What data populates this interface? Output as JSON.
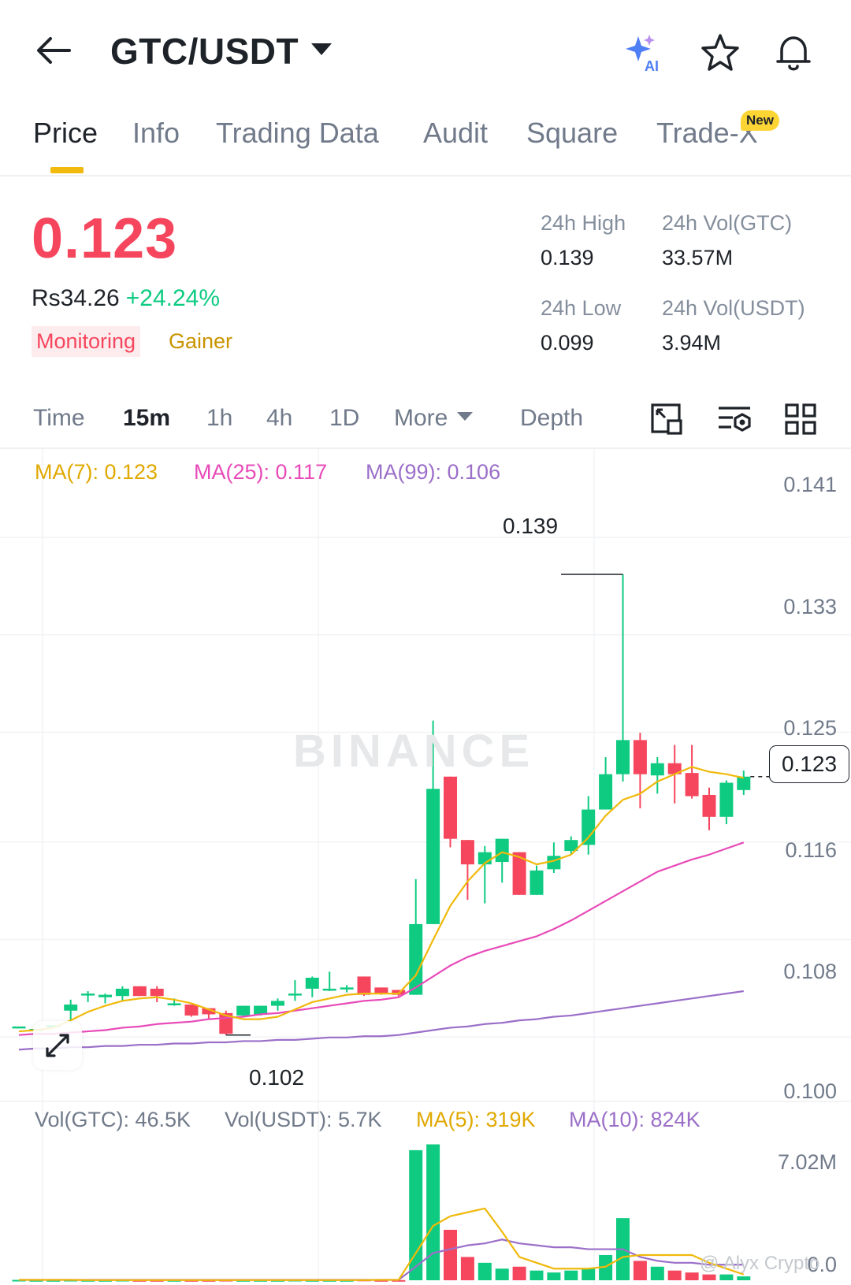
{
  "header": {
    "pair": "GTC/USDT",
    "ai_icon": "ai-sparkle-icon",
    "star_icon": "star-icon",
    "bell_icon": "bell-icon"
  },
  "tabs": [
    {
      "label": "Price",
      "active": true
    },
    {
      "label": "Info"
    },
    {
      "label": "Trading Data"
    },
    {
      "label": "Audit"
    },
    {
      "label": "Square"
    },
    {
      "label": "Trade-X",
      "badge": "New"
    }
  ],
  "price": {
    "last": "0.123",
    "fiat": "Rs34.26",
    "change": "+24.24%",
    "tags": [
      "Monitoring",
      "Gainer"
    ]
  },
  "stats": {
    "high_label": "24h High",
    "high_value": "0.139",
    "vol_base_label": "24h Vol(GTC)",
    "vol_base_value": "33.57M",
    "low_label": "24h Low",
    "low_value": "0.099",
    "vol_quote_label": "24h Vol(USDT)",
    "vol_quote_value": "3.94M"
  },
  "intervals": {
    "time": "Time",
    "m15": "15m",
    "h1": "1h",
    "h4": "4h",
    "d1": "1D",
    "more": "More",
    "depth": "Depth"
  },
  "indicators": {
    "ma7": "MA(7): 0.123",
    "ma25": "MA(25): 0.117",
    "ma99": "MA(99): 0.106",
    "vol_base": "Vol(GTC): 46.5K",
    "vol_quote": "Vol(USDT): 5.7K",
    "vol_ma5": "MA(5): 319K",
    "vol_ma10": "MA(10): 824K"
  },
  "colors": {
    "up": "#0ecb81",
    "down": "#f6465d",
    "ma7": "#f0b90b",
    "ma25": "#e84ab8",
    "ma99": "#9b6fc9",
    "accent": "#f0b90b"
  },
  "watermark": "BINANCE",
  "credit": "@ Alyx Crypto",
  "chart_data": {
    "type": "candlestick",
    "y_axis_labels": [
      "0.141",
      "0.133",
      "0.125",
      "0.116",
      "0.108",
      "0.100"
    ],
    "ylim": [
      0.0995,
      0.1432
    ],
    "current_price": "0.123",
    "high_mark": "0.139",
    "low_mark": "0.102",
    "candles": [
      {
        "o": 0.1019,
        "h": 0.1019,
        "l": 0.1019,
        "c": 0.1019
      },
      {
        "o": 0.1017,
        "h": 0.1017,
        "l": 0.1017,
        "c": 0.1017
      },
      {
        "o": 0.1019,
        "h": 0.102,
        "l": 0.1019,
        "c": 0.102
      },
      {
        "o": 0.1032,
        "h": 0.1041,
        "l": 0.1022,
        "c": 0.1037
      },
      {
        "o": 0.1045,
        "h": 0.1048,
        "l": 0.1039,
        "c": 0.1046
      },
      {
        "o": 0.1043,
        "h": 0.1046,
        "l": 0.1038,
        "c": 0.1045
      },
      {
        "o": 0.1044,
        "h": 0.1052,
        "l": 0.104,
        "c": 0.105
      },
      {
        "o": 0.1052,
        "h": 0.1052,
        "l": 0.1044,
        "c": 0.1044
      },
      {
        "o": 0.105,
        "h": 0.1052,
        "l": 0.1039,
        "c": 0.1044
      },
      {
        "o": 0.1038,
        "h": 0.1042,
        "l": 0.1036,
        "c": 0.1038
      },
      {
        "o": 0.1037,
        "h": 0.1037,
        "l": 0.1027,
        "c": 0.1028
      },
      {
        "o": 0.1034,
        "h": 0.1034,
        "l": 0.1025,
        "c": 0.1029
      },
      {
        "o": 0.103,
        "h": 0.1032,
        "l": 0.1012,
        "c": 0.1013
      },
      {
        "o": 0.1028,
        "h": 0.1036,
        "l": 0.1027,
        "c": 0.1036
      },
      {
        "o": 0.1029,
        "h": 0.1036,
        "l": 0.1028,
        "c": 0.1036
      },
      {
        "o": 0.1036,
        "h": 0.1042,
        "l": 0.1032,
        "c": 0.104
      },
      {
        "o": 0.1045,
        "h": 0.1057,
        "l": 0.104,
        "c": 0.1046
      },
      {
        "o": 0.105,
        "h": 0.106,
        "l": 0.1043,
        "c": 0.1059
      },
      {
        "o": 0.105,
        "h": 0.1064,
        "l": 0.1048,
        "c": 0.105
      },
      {
        "o": 0.105,
        "h": 0.1053,
        "l": 0.1047,
        "c": 0.1051
      },
      {
        "o": 0.106,
        "h": 0.106,
        "l": 0.1044,
        "c": 0.1045
      },
      {
        "o": 0.1051,
        "h": 0.1051,
        "l": 0.1045,
        "c": 0.1046
      },
      {
        "o": 0.1049,
        "h": 0.1049,
        "l": 0.1044,
        "c": 0.1045
      },
      {
        "o": 0.1045,
        "h": 0.114,
        "l": 0.1045,
        "c": 0.1103
      },
      {
        "o": 0.1103,
        "h": 0.127,
        "l": 0.1103,
        "c": 0.1214
      },
      {
        "o": 0.1224,
        "h": 0.1224,
        "l": 0.1166,
        "c": 0.1173
      },
      {
        "o": 0.1172,
        "h": 0.1172,
        "l": 0.1123,
        "c": 0.1152
      },
      {
        "o": 0.1152,
        "h": 0.1167,
        "l": 0.112,
        "c": 0.1162
      },
      {
        "o": 0.1154,
        "h": 0.1173,
        "l": 0.1137,
        "c": 0.1173
      },
      {
        "o": 0.1162,
        "h": 0.1162,
        "l": 0.1127,
        "c": 0.1127
      },
      {
        "o": 0.1127,
        "h": 0.1151,
        "l": 0.1127,
        "c": 0.1147
      },
      {
        "o": 0.1148,
        "h": 0.117,
        "l": 0.1145,
        "c": 0.1159
      },
      {
        "o": 0.1163,
        "h": 0.1175,
        "l": 0.116,
        "c": 0.1172
      },
      {
        "o": 0.1168,
        "h": 0.1208,
        "l": 0.116,
        "c": 0.1197
      },
      {
        "o": 0.1197,
        "h": 0.124,
        "l": 0.1197,
        "c": 0.1226
      },
      {
        "o": 0.1226,
        "h": 0.139,
        "l": 0.122,
        "c": 0.1254
      },
      {
        "o": 0.1254,
        "h": 0.126,
        "l": 0.1198,
        "c": 0.1226
      },
      {
        "o": 0.1225,
        "h": 0.124,
        "l": 0.121,
        "c": 0.1235
      },
      {
        "o": 0.1235,
        "h": 0.125,
        "l": 0.1202,
        "c": 0.1226
      },
      {
        "o": 0.1227,
        "h": 0.125,
        "l": 0.1206,
        "c": 0.1208
      },
      {
        "o": 0.1209,
        "h": 0.1215,
        "l": 0.118,
        "c": 0.1191
      },
      {
        "o": 0.1191,
        "h": 0.1221,
        "l": 0.1185,
        "c": 0.1219
      },
      {
        "o": 0.1213,
        "h": 0.1229,
        "l": 0.1209,
        "c": 0.1224
      }
    ],
    "ma7": [
      0.1015,
      0.1016,
      0.1018,
      0.1024,
      0.1031,
      0.1036,
      0.104,
      0.1042,
      0.1043,
      0.1041,
      0.1038,
      0.1033,
      0.1028,
      0.1025,
      0.1025,
      0.1027,
      0.1033,
      0.1039,
      0.1042,
      0.1045,
      0.1046,
      0.1046,
      0.1046,
      0.1061,
      0.109,
      0.1118,
      0.1138,
      0.1153,
      0.1162,
      0.1158,
      0.1152,
      0.1155,
      0.116,
      0.1174,
      0.1192,
      0.1205,
      0.121,
      0.122,
      0.1226,
      0.1232,
      0.1228,
      0.1226,
      0.1223
    ],
    "ma25": [
      0.1012,
      0.1013,
      0.1013,
      0.1014,
      0.1015,
      0.1016,
      0.1018,
      0.1019,
      0.1021,
      0.1022,
      0.1023,
      0.1025,
      0.1026,
      0.1027,
      0.1029,
      0.103,
      0.1032,
      0.1034,
      0.1036,
      0.1038,
      0.104,
      0.1041,
      0.1043,
      0.1051,
      0.106,
      0.1069,
      0.1076,
      0.1081,
      0.1085,
      0.1089,
      0.1093,
      0.1099,
      0.1106,
      0.1114,
      0.1122,
      0.113,
      0.1138,
      0.1146,
      0.1151,
      0.1156,
      0.116,
      0.1165,
      0.117
    ],
    "ma99": [
      0.1,
      0.1001,
      0.1001,
      0.1002,
      0.1002,
      0.1003,
      0.1003,
      0.1004,
      0.1004,
      0.1005,
      0.1005,
      0.1006,
      0.1006,
      0.1007,
      0.1007,
      0.1008,
      0.1008,
      0.1009,
      0.101,
      0.101,
      0.1011,
      0.1011,
      0.1012,
      0.1014,
      0.1016,
      0.1018,
      0.1019,
      0.1021,
      0.1022,
      0.1024,
      0.1025,
      0.1027,
      0.1028,
      0.103,
      0.1032,
      0.1034,
      0.1036,
      0.1038,
      0.104,
      0.1042,
      0.1044,
      0.1046,
      0.1048
    ],
    "volume": {
      "y_axis_labels": [
        "7.02M",
        "0.0"
      ],
      "ylim": [
        0,
        7.02
      ],
      "unit": "M",
      "values": [
        0.02,
        0.01,
        0.01,
        0.02,
        0.01,
        0.01,
        0.02,
        0.01,
        0.01,
        0.01,
        0.01,
        0.01,
        0.02,
        0.01,
        0.01,
        0.01,
        0.02,
        0.01,
        0.01,
        0.01,
        0.03,
        0.01,
        0.01,
        6.7,
        7.0,
        2.6,
        1.2,
        0.9,
        0.6,
        0.7,
        0.5,
        0.4,
        0.5,
        0.6,
        1.3,
        3.2,
        1.0,
        0.7,
        0.5,
        0.4,
        0.3,
        0.3,
        0.2
      ],
      "ma5": [
        0.02,
        0.02,
        0.02,
        0.02,
        0.01,
        0.01,
        0.01,
        0.01,
        0.01,
        0.01,
        0.01,
        0.01,
        0.01,
        0.01,
        0.01,
        0.01,
        0.01,
        0.01,
        0.01,
        0.01,
        0.01,
        0.02,
        0.02,
        1.4,
        2.8,
        3.3,
        3.5,
        3.7,
        2.5,
        1.2,
        0.9,
        0.6,
        0.6,
        0.6,
        0.7,
        1.2,
        1.3,
        1.3,
        1.3,
        1.3,
        0.9,
        0.6,
        0.3
      ],
      "ma10": [
        0.02,
        0.02,
        0.02,
        0.02,
        0.02,
        0.02,
        0.02,
        0.02,
        0.02,
        0.02,
        0.02,
        0.02,
        0.02,
        0.02,
        0.02,
        0.02,
        0.02,
        0.02,
        0.02,
        0.02,
        0.02,
        0.02,
        0.02,
        0.7,
        1.4,
        1.6,
        1.8,
        1.9,
        2.1,
        1.9,
        1.8,
        1.7,
        1.7,
        1.6,
        1.6,
        1.6,
        1.2,
        1.0,
        0.9,
        0.9,
        0.8,
        0.8,
        0.8
      ]
    }
  }
}
